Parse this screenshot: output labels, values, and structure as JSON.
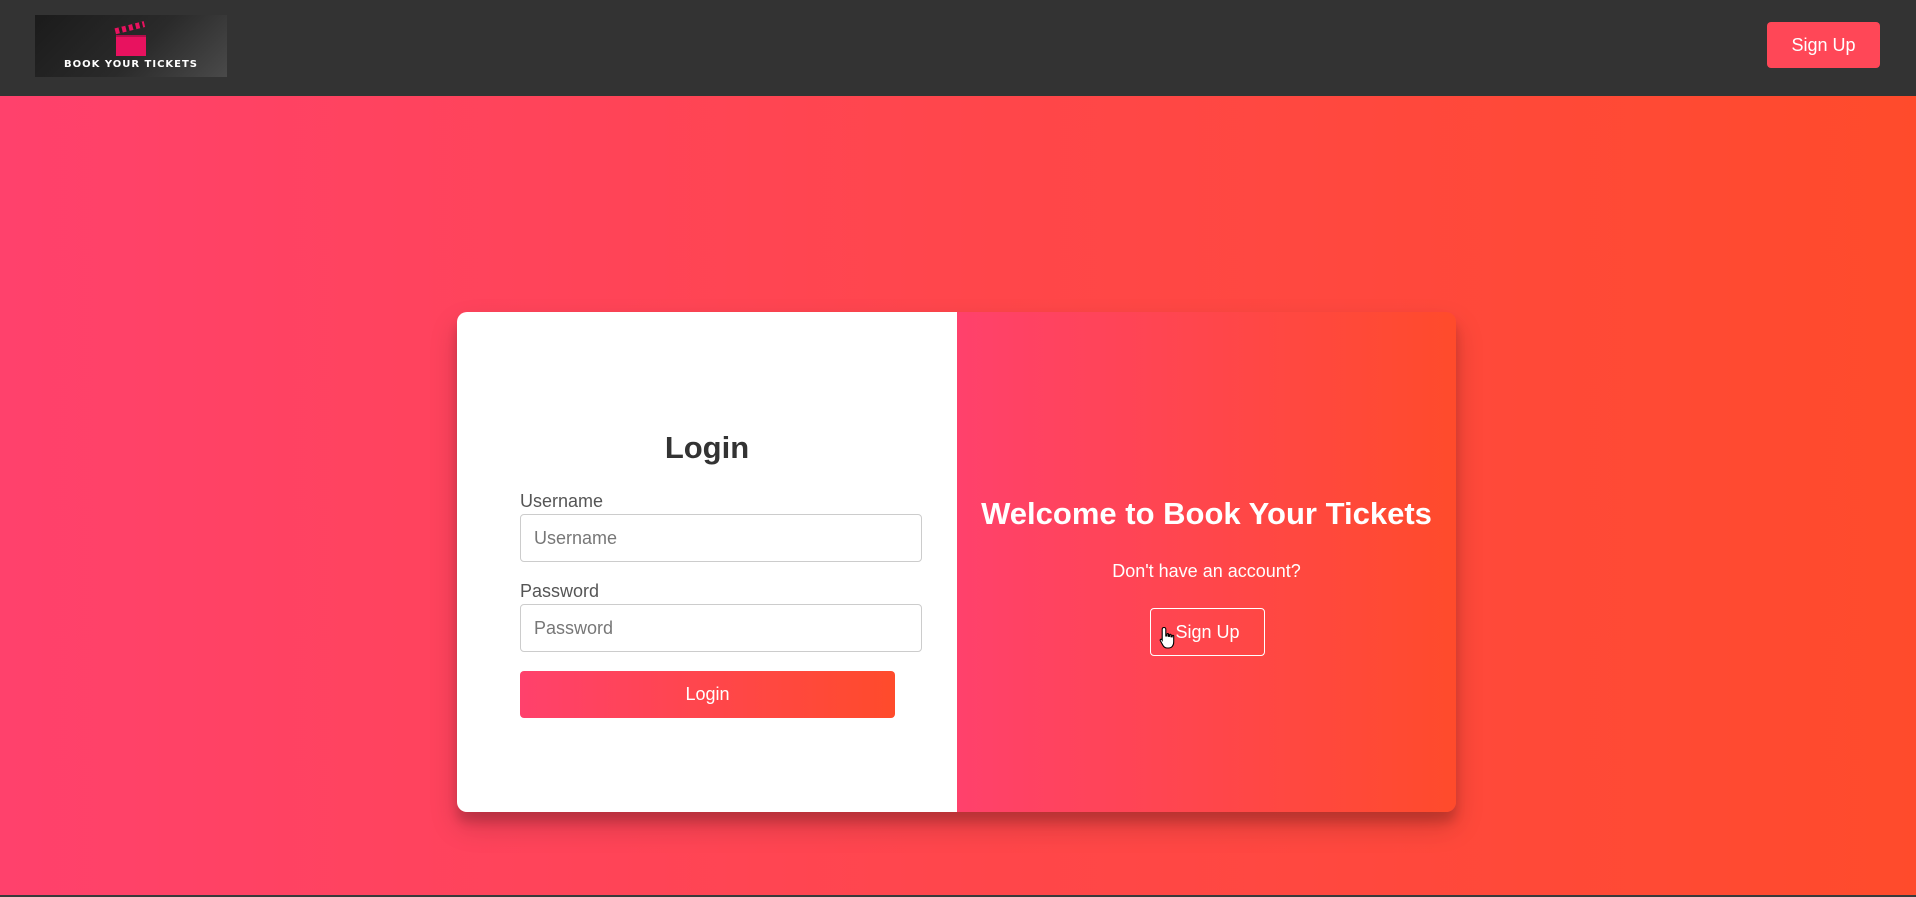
{
  "header": {
    "logo_text": "BOOK YOUR TICKETS",
    "signup_label": "Sign Up"
  },
  "login": {
    "title": "Login",
    "username_label": "Username",
    "username_placeholder": "Username",
    "password_label": "Password",
    "password_placeholder": "Password",
    "submit_label": "Login"
  },
  "welcome_panel": {
    "title": "Welcome to Book Your Tickets",
    "prompt": "Don't have an account?",
    "signup_label": "Sign Up"
  },
  "colors": {
    "navbar": "#333333",
    "accent": "#ff4757",
    "gradient_start": "#ff416c",
    "gradient_end": "#ff4b2b"
  },
  "icons": {
    "logo": "clapperboard-icon",
    "cursor": "hand-pointer-icon"
  }
}
